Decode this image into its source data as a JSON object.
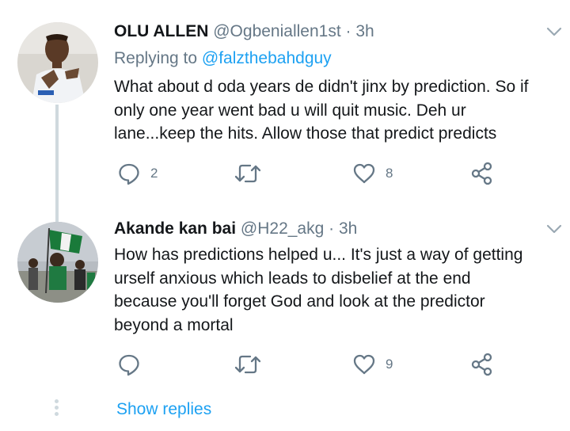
{
  "tweets": [
    {
      "name": "OLU ALLEN",
      "handle": "@Ogbeniallen1st",
      "separator": "·",
      "time": "3h",
      "replying_prefix": "Replying to",
      "replying_to": "@falzthebahdguy",
      "lines": [
        "What about d oda years de didn't jinx by prediction. So if",
        "only one year went bad u will quit music. Deh ur",
        "lane...keep the hits. Allow those that predict predicts"
      ],
      "reply_count": "2",
      "retweet_count": "",
      "like_count": "8"
    },
    {
      "name": "Akande kan bai",
      "handle": "@H22_akg",
      "separator": "·",
      "time": "3h",
      "lines": [
        "How has predictions helped u... It's just a way of getting",
        "urself anxious which leads to disbelief at the end",
        "because you'll forget God and look at the predictor",
        "beyond a mortal"
      ],
      "reply_count": "",
      "retweet_count": "",
      "like_count": "9"
    }
  ],
  "show_replies": "Show replies",
  "colors": {
    "accent": "#1da1f2",
    "muted": "#657786",
    "text": "#14171a",
    "thread": "#cfd9de"
  },
  "icons": [
    "reply-icon",
    "retweet-icon",
    "like-icon",
    "share-icon",
    "caret-down-icon"
  ]
}
